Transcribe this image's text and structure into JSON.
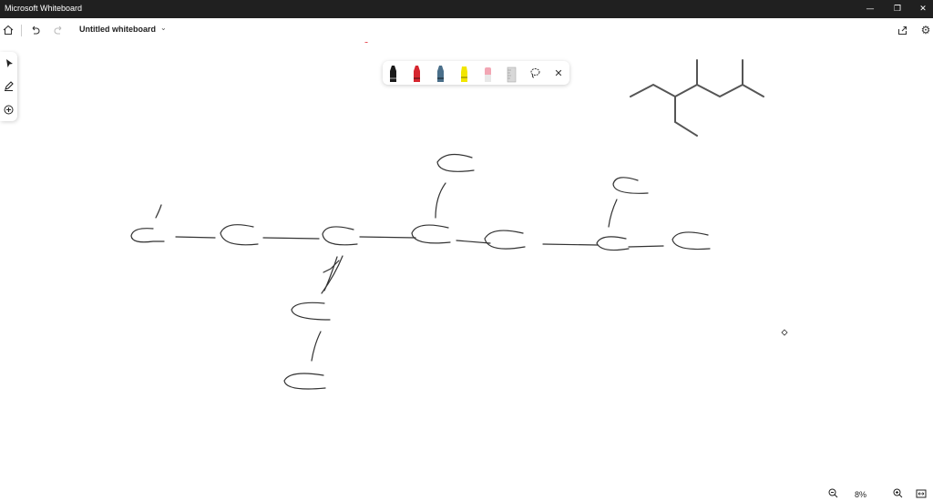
{
  "window": {
    "title": "Microsoft Whiteboard",
    "minimize_icon": "minimize-icon",
    "maximize_icon": "restore-icon",
    "close_icon": "close-icon"
  },
  "toolbar": {
    "home_icon": "home-icon",
    "undo_icon": "undo-icon",
    "redo_icon": "redo-icon",
    "board_title": "Untitled whiteboard",
    "share_icon": "share-icon",
    "settings_icon": "gear-icon"
  },
  "left_rail": {
    "items": [
      "select-arrow-icon",
      "pen-draw-icon",
      "add-icon"
    ]
  },
  "pen_tray": {
    "pens": [
      {
        "name": "black-pen",
        "color": "#1a1a1a"
      },
      {
        "name": "red-pen",
        "color": "#d6262f"
      },
      {
        "name": "blue-pen",
        "color": "#4a6f8a"
      },
      {
        "name": "yellow-highlighter",
        "color": "#f2e600"
      },
      {
        "name": "eraser",
        "color": "#f2a6b4"
      },
      {
        "name": "ruler",
        "color": "#c8c8c8"
      }
    ],
    "lasso_icon": "lasso-icon",
    "close_icon": "close-icon"
  },
  "canvas": {
    "ink_color": "#333333",
    "structure_color": "#555555",
    "red_ink": "#e0202a"
  },
  "zoom": {
    "zoom_out_icon": "zoom-out-icon",
    "level": "8%",
    "zoom_in_icon": "zoom-in-icon",
    "fit_icon": "fit-to-screen-icon"
  }
}
